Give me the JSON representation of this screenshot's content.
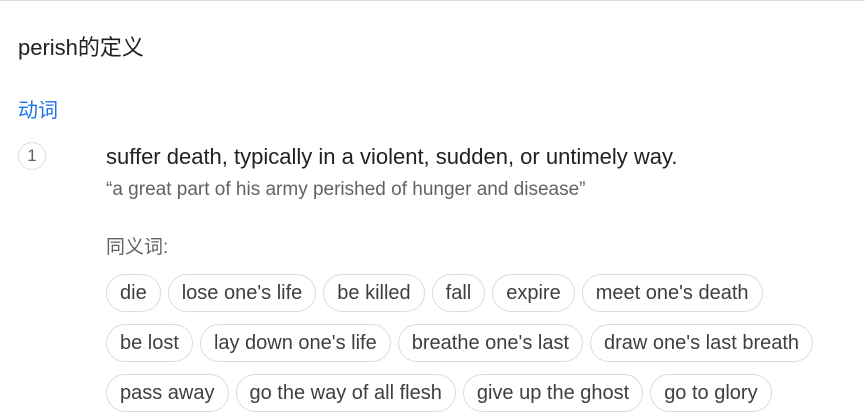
{
  "header": {
    "title": "perish的定义"
  },
  "entry": {
    "part_of_speech": "动词",
    "sense": {
      "number": "1",
      "definition": "suffer death, typically in a violent, sudden, or untimely way.",
      "example": "“a great part of his army perished of hunger and disease”"
    },
    "synonyms_label": "同义词:",
    "synonym_rows": [
      [
        "die",
        "lose one's life",
        "be killed",
        "fall",
        "expire",
        "meet one's death"
      ],
      [
        "be lost",
        "lay down one's life",
        "breathe one's last",
        "draw one's last breath"
      ],
      [
        "pass away",
        "go the way of all flesh",
        "give up the ghost",
        "go to glory"
      ]
    ]
  }
}
